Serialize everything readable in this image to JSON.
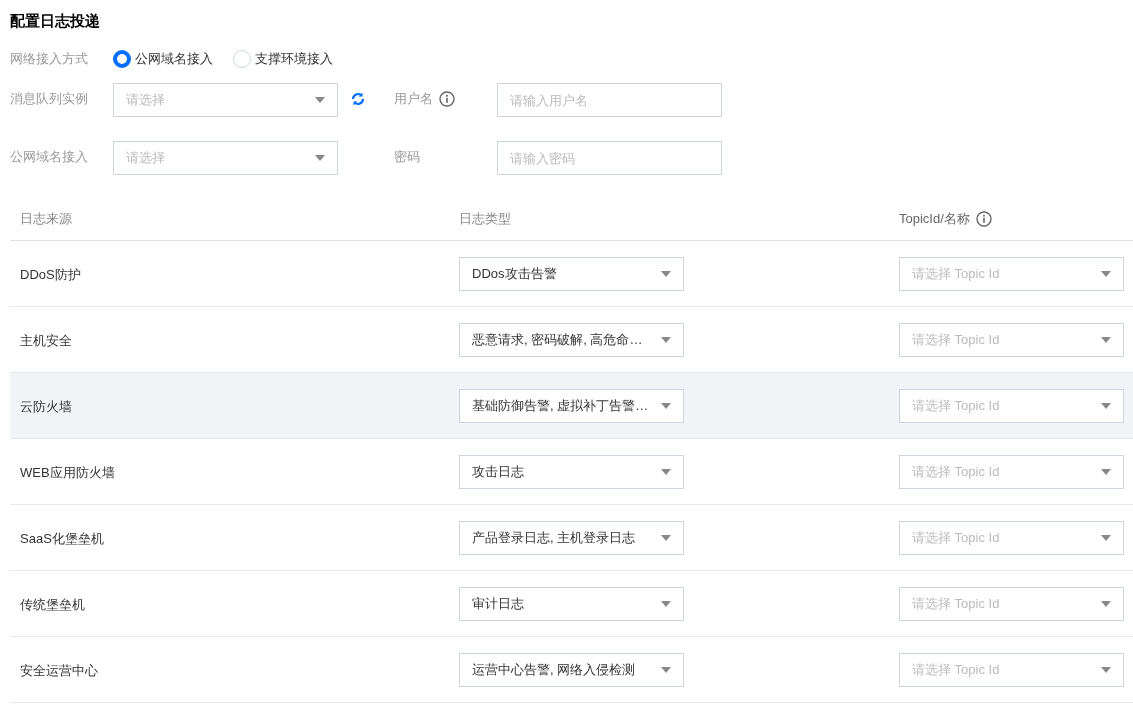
{
  "title": "配置日志投递",
  "access_mode": {
    "label": "网络接入方式",
    "options": [
      {
        "label": "公网域名接入",
        "selected": true
      },
      {
        "label": "支撑环境接入",
        "selected": false
      }
    ]
  },
  "form": {
    "instance": {
      "label": "消息队列实例",
      "placeholder": "请选择"
    },
    "domain": {
      "label": "公网域名接入",
      "placeholder": "请选择"
    },
    "username": {
      "label": "用户名",
      "placeholder": "请输入用户名"
    },
    "password": {
      "label": "密码",
      "placeholder": "请输入密码"
    }
  },
  "table": {
    "columns": [
      "日志来源",
      "日志类型",
      "TopicId/名称"
    ],
    "rows": [
      {
        "source": "DDoS防护",
        "log_type": "DDos攻击告警",
        "topic_placeholder": "请选择 Topic Id",
        "hovered": false
      },
      {
        "source": "主机安全",
        "log_type": "恶意请求, 密码破解, 高危命…",
        "topic_placeholder": "请选择 Topic Id",
        "hovered": false
      },
      {
        "source": "云防火墙",
        "log_type": "基础防御告警, 虚拟补丁告警…",
        "topic_placeholder": "请选择 Topic Id",
        "hovered": true
      },
      {
        "source": "WEB应用防火墙",
        "log_type": "攻击日志",
        "topic_placeholder": "请选择 Topic Id",
        "hovered": false
      },
      {
        "source": "SaaS化堡垒机",
        "log_type": "产品登录日志, 主机登录日志",
        "topic_placeholder": "请选择 Topic Id",
        "hovered": false
      },
      {
        "source": "传统堡垒机",
        "log_type": "审计日志",
        "topic_placeholder": "请选择 Topic Id",
        "hovered": false
      },
      {
        "source": "安全运营中心",
        "log_type": "运营中心告警, 网络入侵检测",
        "topic_placeholder": "请选择 Topic Id",
        "hovered": false
      }
    ]
  }
}
